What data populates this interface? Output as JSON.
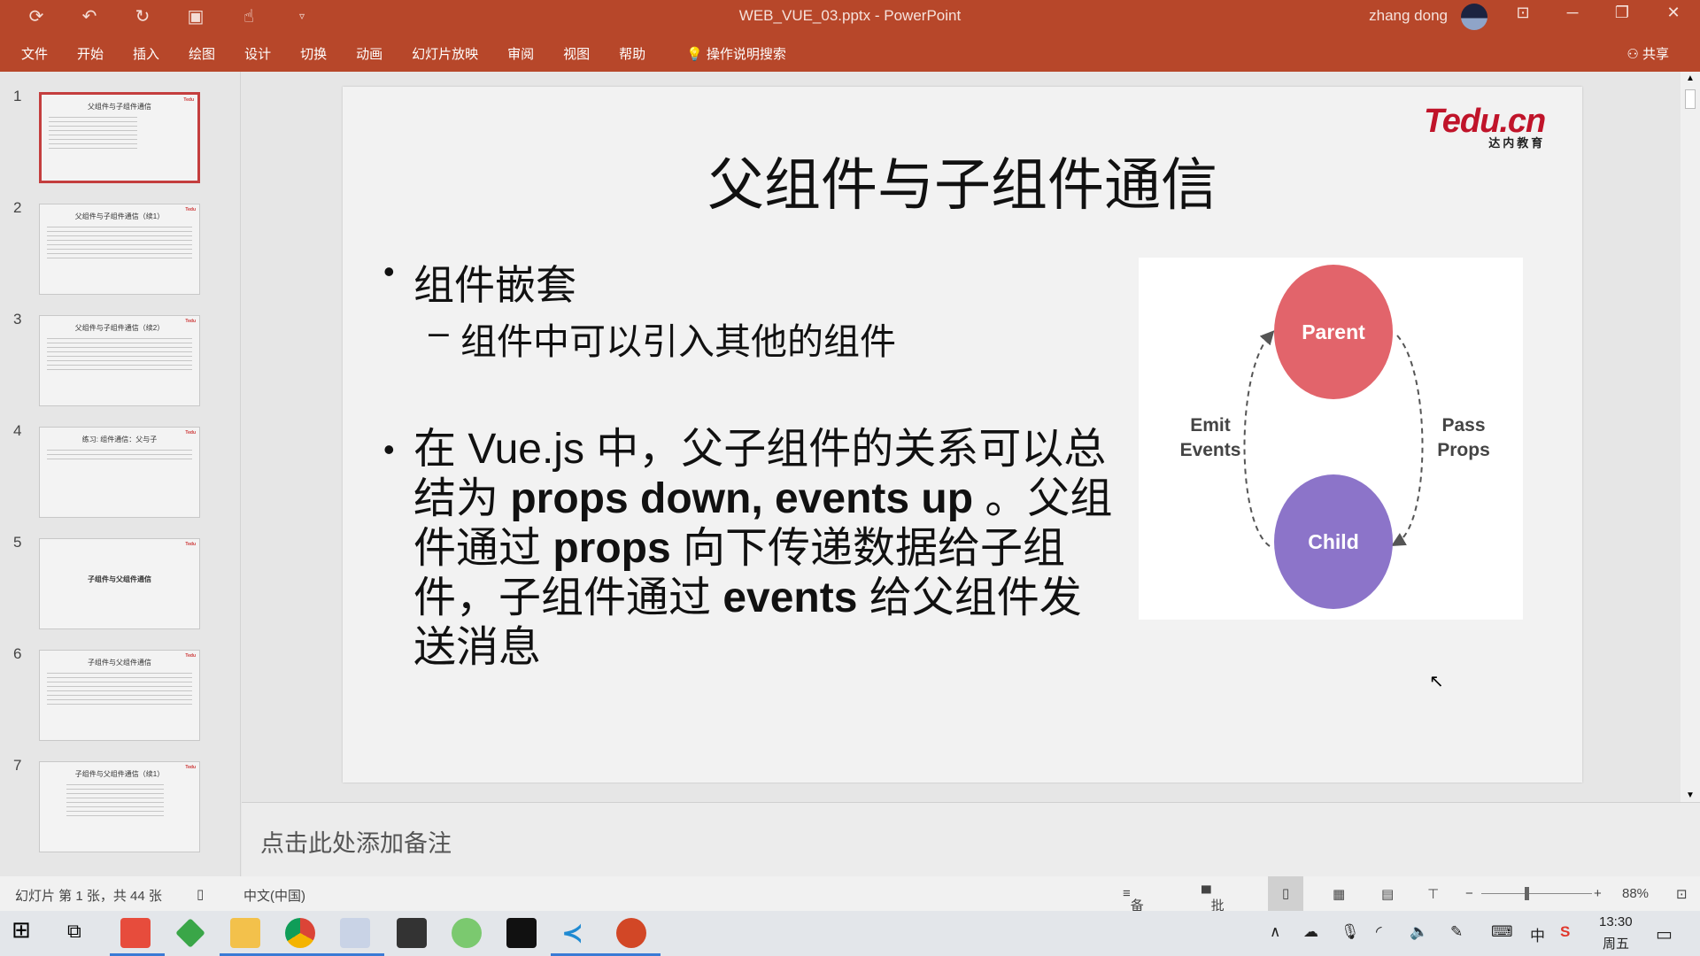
{
  "window": {
    "title": "WEB_VUE_03.pptx - PowerPoint",
    "user": "zhang dong",
    "share": "共享",
    "search": "操作说明搜索"
  },
  "quick_access": {
    "icons": [
      "save-icon",
      "undo-icon",
      "redo-icon",
      "start-slideshow-icon",
      "touch-mode-icon",
      "customize-icon"
    ]
  },
  "menu": [
    "文件",
    "开始",
    "插入",
    "绘图",
    "设计",
    "切换",
    "动画",
    "幻灯片放映",
    "审阅",
    "视图",
    "帮助"
  ],
  "thumbnails": [
    {
      "num": "1",
      "title": "父组件与子组件通信"
    },
    {
      "num": "2",
      "title": "父组件与子组件通信（续1）"
    },
    {
      "num": "3",
      "title": "父组件与子组件通信（续2）"
    },
    {
      "num": "4",
      "title": "练习: 组件通信：父与子"
    },
    {
      "num": "5",
      "title": "子组件与父组件通信"
    },
    {
      "num": "6",
      "title": "子组件与父组件通信"
    },
    {
      "num": "7",
      "title": "子组件与父组件通信（续1）"
    }
  ],
  "slide": {
    "title": "父组件与子组件通信",
    "logo": "Tedu.cn",
    "logo_sub": "达内教育",
    "bullet1": "组件嵌套",
    "sub1": "组件中可以引入其他的组件",
    "bullet2": {
      "t1": "在 Vue.js 中，父子组件的关系可以总结为 ",
      "b1": "props down, events up",
      "t2": " 。父组件通过 ",
      "b2": "props",
      "t3": " 向下传递数据给子组件，子组件通过 ",
      "b3": "events",
      "t4": " 给父组件发送消息"
    },
    "diagram": {
      "parent": "Parent",
      "child": "Child",
      "left_label": [
        "Emit",
        "Events"
      ],
      "right_label": [
        "Pass",
        "Props"
      ],
      "parent_color": "#e2646b",
      "child_color": "#8c74c9"
    }
  },
  "notes_placeholder": "点击此处添加备注",
  "status": {
    "slide_info": "幻灯片 第 1 张，共 44 张",
    "language": "中文(中国)",
    "notes": "备注",
    "comments": "批注",
    "zoom": "88%",
    "zoom_level": 88
  },
  "taskbar": {
    "time": "13:30",
    "day": "周五",
    "ime": "中"
  },
  "colors": {
    "accent": "#b7472a",
    "selected_thumb": "#c43e3e"
  }
}
